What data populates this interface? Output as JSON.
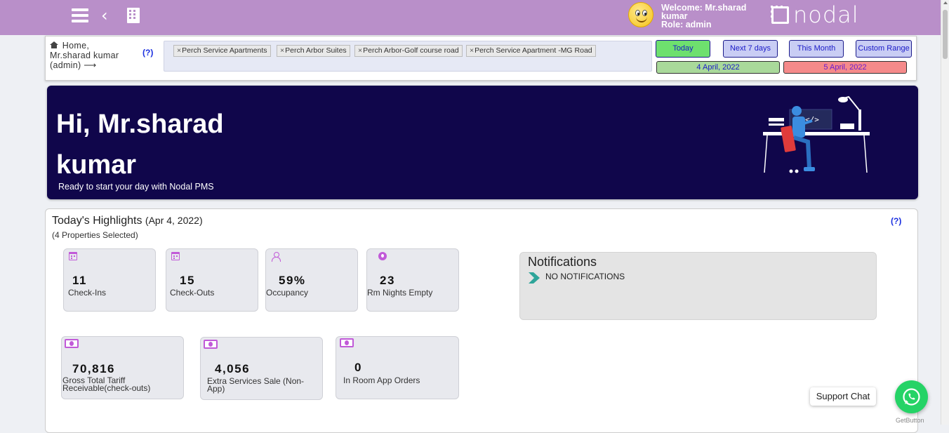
{
  "header": {
    "welcome_line1": "Welcome: Mr.sharad",
    "welcome_line2": "kumar",
    "role": "Role: admin",
    "logo_text": "nodal",
    "accent_color": "#b98fc9"
  },
  "breadcrumb": {
    "line1": "Home,",
    "line2": "Mr.sharad kumar",
    "line3": "(admin) ⟶",
    "help": "(?)"
  },
  "properties": [
    "Perch Service Apartments",
    "Perch Arbor Suites",
    "Perch Arbor-Golf course road",
    "Perch Service Apartment -MG Road"
  ],
  "date_buttons": {
    "today": "Today",
    "next7": "Next 7 days",
    "month": "This Month",
    "custom": "Custom Range"
  },
  "date_range": {
    "start": "4 April, 2022",
    "end": "5 April, 2022"
  },
  "hero": {
    "greeting": "Hi, Mr.sharad kumar",
    "subtitle": "Ready to start your day with Nodal PMS"
  },
  "highlights": {
    "title": "Today's Highlights",
    "date": "(Apr 4, 2022)",
    "subtitle": "(4 Properties Selected)",
    "help": "(?)",
    "stats": [
      {
        "value": "11",
        "label": "Check-Ins",
        "icon": "calendar-icon"
      },
      {
        "value": "15",
        "label": "Check-Outs",
        "icon": "calendar-icon"
      },
      {
        "value": "59%",
        "label": "Occupancy",
        "icon": "user-icon"
      },
      {
        "value": "23",
        "label": "Rm Nights Empty",
        "icon": "badge-icon"
      }
    ],
    "revenue": [
      {
        "value": "70,816",
        "label": "Gross Total Tariff Receivable(check-outs)",
        "icon": "money-icon"
      },
      {
        "value": "4,056",
        "label": "Extra Services Sale (Non-App)",
        "icon": "money-icon"
      },
      {
        "value": "0",
        "label": "In Room App Orders",
        "icon": "money-icon"
      }
    ]
  },
  "notifications": {
    "title": "Notifications",
    "empty_text": "NO NOTIFICATIONS"
  },
  "support": {
    "label": "Support Chat",
    "powered_by": "GetButton"
  }
}
